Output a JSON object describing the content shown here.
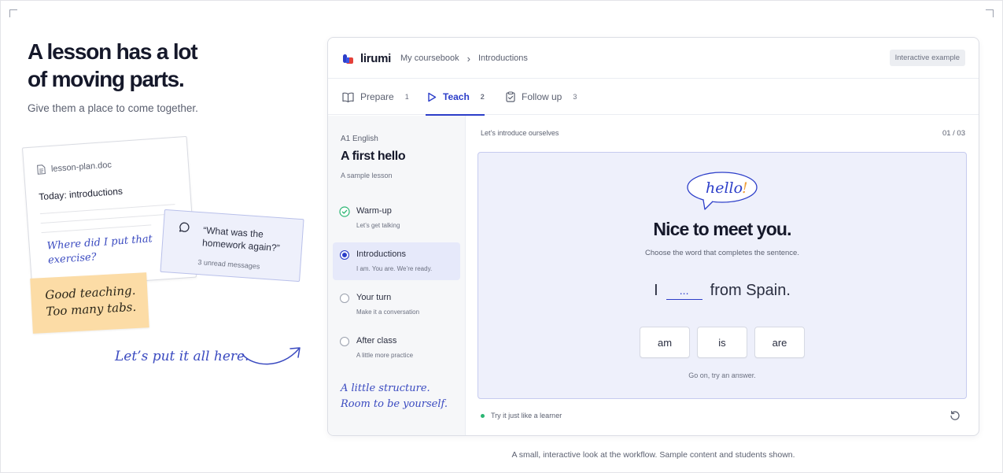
{
  "hero": {
    "title_line1": "A lesson has a lot",
    "title_line2": "of moving parts.",
    "subtitle": "Give them a place to come together."
  },
  "doc_card": {
    "filename": "lesson-plan.doc",
    "heading": "Today: introductions",
    "handwritten_line1": "Where did I put that",
    "handwritten_line2": "exercise?"
  },
  "chat_card": {
    "quote_line1": "“What was the",
    "quote_line2": "homework again?”",
    "meta": "3 unread messages"
  },
  "sticky_note": {
    "line1": "Good teaching.",
    "line2": "Too many tabs."
  },
  "cta": {
    "text": "Let’s put it all here."
  },
  "app": {
    "brand": "lirumi",
    "breadcrumb": [
      "My coursebook",
      "Introductions"
    ],
    "badge": "Interactive example",
    "tabs": [
      {
        "label": "Prepare",
        "num": "1",
        "icon": "book-icon",
        "active": false
      },
      {
        "label": "Teach",
        "num": "2",
        "icon": "play-icon",
        "active": true
      },
      {
        "label": "Follow up",
        "num": "3",
        "icon": "clipboard-check-icon",
        "active": false
      }
    ],
    "sidebar": {
      "level": "A1 English",
      "title": "A first hello",
      "description": "A sample lesson",
      "steps": [
        {
          "label": "Warm-up",
          "sub": "Let’s get talking",
          "state": "done"
        },
        {
          "label": "Introductions",
          "sub": "I am. You are. We’re ready.",
          "state": "current"
        },
        {
          "label": "Your turn",
          "sub": "Make it a conversation",
          "state": "todo"
        },
        {
          "label": "After class",
          "sub": "A little more practice",
          "state": "todo"
        }
      ],
      "handwritten_line1": "A little structure.",
      "handwritten_line2": "Room to be yourself."
    },
    "main": {
      "section_label": "Let’s introduce ourselves",
      "counter": "01 / 03",
      "bubble_text": "hello",
      "bubble_mark": "!",
      "exercise_title": "Nice to meet you.",
      "instruction": "Choose the word that completes the sentence.",
      "sentence_before": "I",
      "blank": "...",
      "sentence_after": "from Spain.",
      "options": [
        "am",
        "is",
        "are"
      ],
      "hint": "Go on, try an answer.",
      "status": "Try it just like a learner"
    }
  },
  "caption": "A small, interactive look at the workflow. Sample content and students shown.",
  "colors": {
    "accent": "#2c3ec9",
    "handwriting": "#3a4ac0",
    "sticky": "#fcdca6",
    "exercise_bg": "#eef0fb",
    "success": "#2bb673",
    "bubble_mark": "#f0a13a"
  }
}
